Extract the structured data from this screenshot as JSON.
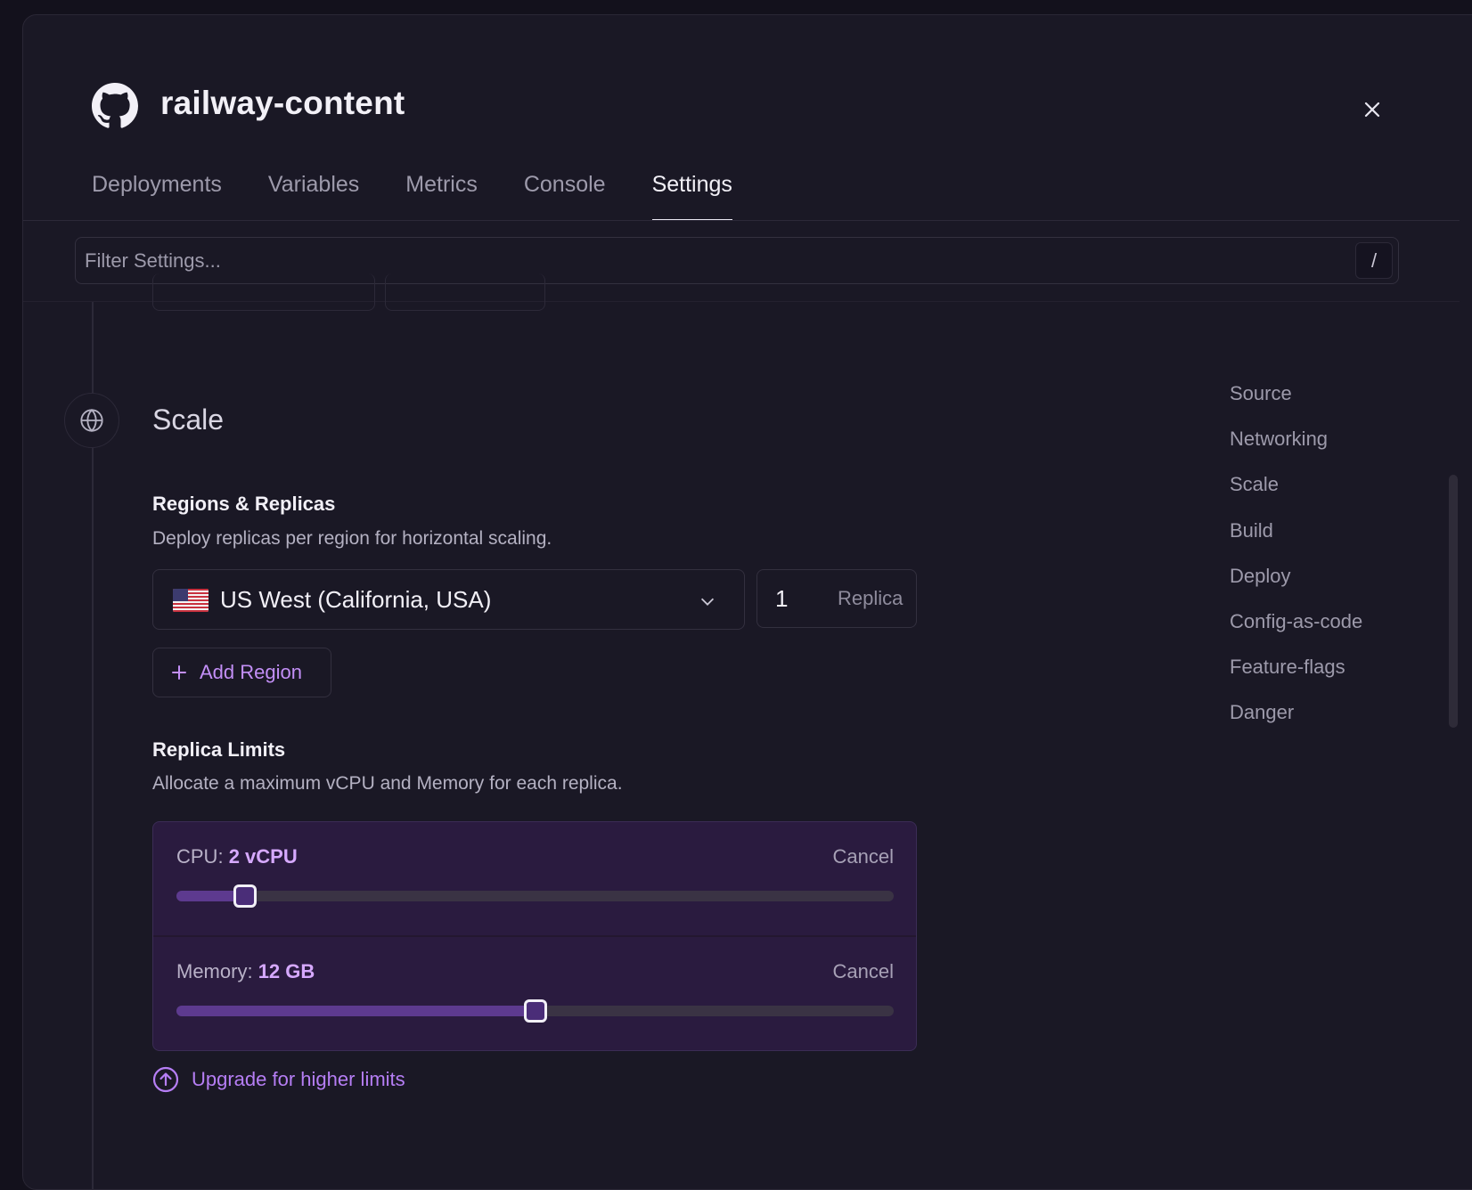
{
  "app": {
    "title": "railway-content",
    "tabs": [
      {
        "label": "Deployments",
        "active": false
      },
      {
        "label": "Variables",
        "active": false
      },
      {
        "label": "Metrics",
        "active": false
      },
      {
        "label": "Console",
        "active": false
      },
      {
        "label": "Settings",
        "active": true
      }
    ]
  },
  "filter": {
    "placeholder": "Filter Settings...",
    "value": "",
    "shortcut": "/"
  },
  "scale": {
    "section_title": "Scale",
    "regions": {
      "heading": "Regions & Replicas",
      "description": "Deploy replicas per region for horizontal scaling.",
      "selected_region": "US West (California, USA)",
      "replica_count": "1",
      "replica_suffix": "Replica",
      "add_region_label": "Add Region"
    },
    "limits": {
      "heading": "Replica Limits",
      "description": "Allocate a maximum vCPU and Memory for each replica.",
      "cpu": {
        "label": "CPU:",
        "value": "2 vCPU",
        "cancel": "Cancel",
        "fraction": 0.096
      },
      "memory": {
        "label": "Memory:",
        "value": "12 GB",
        "cancel": "Cancel",
        "fraction": 0.5
      },
      "upgrade_label": "Upgrade for higher limits"
    }
  },
  "right_nav": [
    "Source",
    "Networking",
    "Scale",
    "Build",
    "Deploy",
    "Config-as-code",
    "Feature-flags",
    "Danger"
  ],
  "colors": {
    "background": "#1a1825",
    "accent": "#c38ff7",
    "limits_panel": "#2a1b3f"
  },
  "icons": {
    "logo": "github-icon",
    "close": "close-icon",
    "section": "globe-icon",
    "dropdown": "chevron-down-icon",
    "add": "plus-icon",
    "upgrade": "arrow-up-circle-icon",
    "flag": "us-flag-icon"
  }
}
